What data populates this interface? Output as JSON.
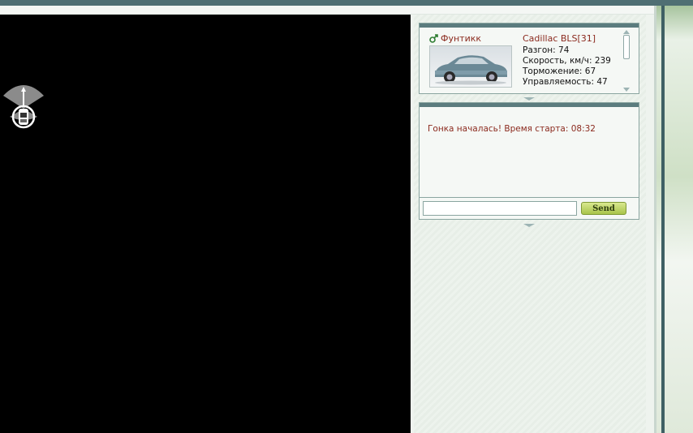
{
  "player": {
    "name": "Фунтикк",
    "car_title": "Cadillac BLS[31]",
    "stats": [
      "Разгон: 74",
      "Скорость, км/ч: 239",
      "Торможение: 67",
      "Управляемость: 47"
    ]
  },
  "chat": {
    "message": "Гонка началась! Время старта: 08:32",
    "input_value": "",
    "send_label": "Send"
  },
  "icons": {
    "gender": "male-icon",
    "scanner": "radar-icon",
    "car": "car-icon"
  },
  "colors": {
    "accent_text": "#8b2a1e",
    "panel_bar": "#5b7c7e",
    "send_button": "#b9d25e",
    "game_background": "#000000"
  }
}
